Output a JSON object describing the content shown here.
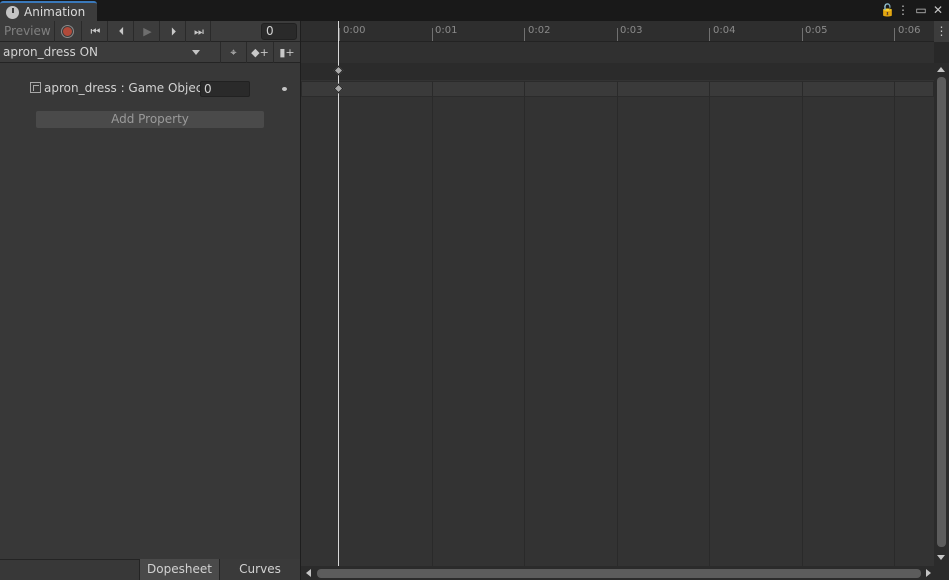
{
  "window": {
    "tab_title": "Animation",
    "icons": [
      "clock-icon",
      "lock-icon",
      "kebab-menu-icon",
      "maximize-icon",
      "close-icon"
    ],
    "controls": {
      "lock": "🔓",
      "menu": "⋮",
      "maximize": "▭",
      "close": "✕"
    }
  },
  "toolbar": {
    "preview_label": "Preview",
    "record_icon": "record-icon",
    "first_key_glyph": "⏮",
    "prev_key_glyph": "⏴",
    "play_glyph": "▶",
    "next_key_glyph": "⏵",
    "last_key_glyph": "⏭",
    "frame_value": "0",
    "record_color": "#b14a3a"
  },
  "clip": {
    "selected": "apron_dress ON",
    "filter_glyph": "⌖",
    "add_key_glyph": "◆+",
    "add_event_glyph": "▮+"
  },
  "properties": [
    {
      "label": "apron_dress : Game Object.",
      "value": "0"
    }
  ],
  "add_property_label": "Add Property",
  "bottom_tabs": [
    "Dopesheet",
    "Curves"
  ],
  "timeline": {
    "ticks": [
      "0:00",
      "0:01",
      "0:02",
      "0:03",
      "0:04",
      "0:05",
      "0:06"
    ],
    "right_menu_glyph": "⋮",
    "keyframes_at": [
      "0:00"
    ]
  }
}
